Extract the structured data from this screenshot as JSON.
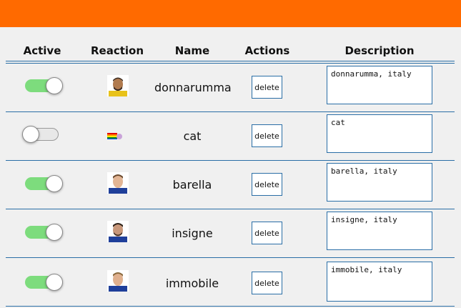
{
  "colors": {
    "topbar": "#ff6a00",
    "border": "#2a6ea6",
    "toggle_on": "#7ddc7d"
  },
  "columns": {
    "active": "Active",
    "reaction": "Reaction",
    "name": "Name",
    "actions": "Actions",
    "description": "Description"
  },
  "rows": [
    {
      "active": true,
      "reaction": "player-avatar",
      "name": "donnarumma",
      "delete_label": "delete",
      "description": "donnarumma, italy"
    },
    {
      "active": false,
      "reaction": "rainbow-flag-emoji",
      "name": "cat",
      "delete_label": "delete",
      "description": "cat"
    },
    {
      "active": true,
      "reaction": "player-avatar",
      "name": "barella",
      "delete_label": "delete",
      "description": "barella, italy"
    },
    {
      "active": true,
      "reaction": "player-avatar",
      "name": "insigne",
      "delete_label": "delete",
      "description": "insigne, italy"
    },
    {
      "active": true,
      "reaction": "player-avatar",
      "name": "immobile",
      "delete_label": "delete",
      "description": "immobile, italy"
    }
  ]
}
